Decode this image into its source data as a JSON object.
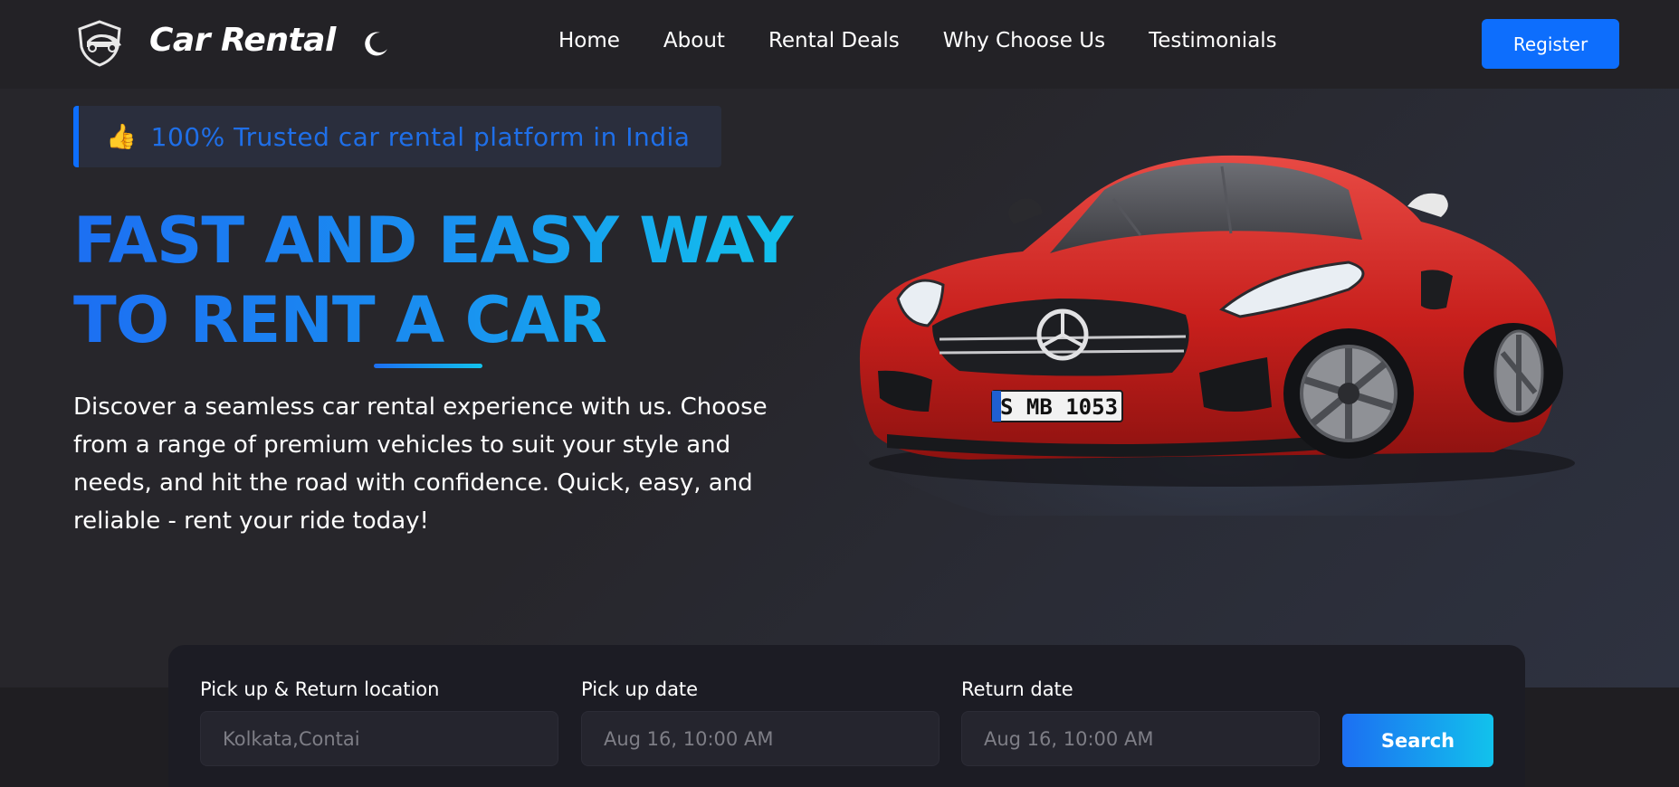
{
  "navbar": {
    "brand": "Car Rental",
    "links": [
      "Home",
      "About",
      "Rental Deals",
      "Why Choose Us",
      "Testimonials"
    ],
    "register_label": "Register",
    "accent_color": "#0d6efd"
  },
  "hero": {
    "badge_icon": "👍",
    "badge_text": "100% Trusted car rental platform in India",
    "headline_line1": "FAST AND EASY WAY",
    "headline_line2": "TO RENT A CAR",
    "description": "Discover a seamless car rental experience with us. Choose from a range of premium vehicles to suit your style and needs, and hit the road with confidence. Quick, easy, and reliable - rent your ride today!",
    "car_plate": "S MB 1053"
  },
  "search": {
    "location_label": "Pick up & Return location",
    "location_placeholder": "Kolkata,Contai",
    "pickup_label": "Pick up date",
    "pickup_value": "Aug 16, 10:00 AM",
    "return_label": "Return date",
    "return_value": "Aug 16, 10:00 AM",
    "search_label": "Search"
  }
}
